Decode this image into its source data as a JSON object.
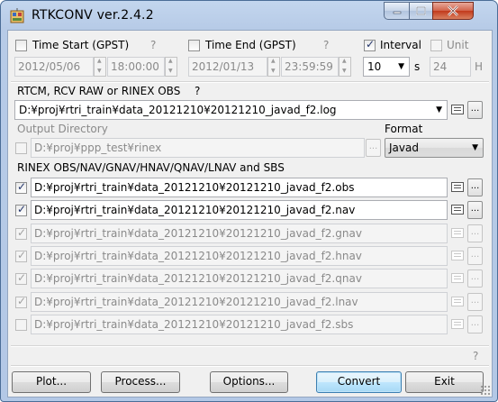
{
  "window": {
    "title": "RTKCONV ver.2.4.2"
  },
  "time": {
    "start_label": "Time Start (GPST)",
    "start_help": "?",
    "start_date": "2012/05/06",
    "start_time": "18:00:00",
    "start_checked": false,
    "end_label": "Time End (GPST)",
    "end_help": "?",
    "end_date": "2012/01/13",
    "end_time": "23:59:59",
    "end_checked": false,
    "interval_label": "Interval",
    "interval_checked": true,
    "interval_value": "10",
    "interval_unit": "s",
    "unit_label": "Unit",
    "unit_checked": false,
    "unit_value": "24",
    "unit_suffix": "H"
  },
  "input": {
    "section_label": "RTCM, RCV RAW or RINEX OBS",
    "help": "?",
    "file": "D:¥proj¥rtri_train¥data_20121210¥20121210_javad_f2.log"
  },
  "output_dir": {
    "label": "Output Directory",
    "value": "D:¥proj¥ppp_test¥rinex",
    "checked": false
  },
  "format": {
    "label": "Format",
    "value": "Javad"
  },
  "outputs": {
    "section_label": "RINEX OBS/NAV/GNAV/HNAV/QNAV/LNAV and SBS",
    "files": [
      {
        "path": "D:¥proj¥rtri_train¥data_20121210¥20121210_javad_f2.obs",
        "checked": true,
        "enabled": true
      },
      {
        "path": "D:¥proj¥rtri_train¥data_20121210¥20121210_javad_f2.nav",
        "checked": true,
        "enabled": true
      },
      {
        "path": "D:¥proj¥rtri_train¥data_20121210¥20121210_javad_f2.gnav",
        "checked": true,
        "enabled": false
      },
      {
        "path": "D:¥proj¥rtri_train¥data_20121210¥20121210_javad_f2.hnav",
        "checked": true,
        "enabled": false
      },
      {
        "path": "D:¥proj¥rtri_train¥data_20121210¥20121210_javad_f2.qnav",
        "checked": true,
        "enabled": false
      },
      {
        "path": "D:¥proj¥rtri_train¥data_20121210¥20121210_javad_f2.lnav",
        "checked": true,
        "enabled": false
      },
      {
        "path": "D:¥proj¥rtri_train¥data_20121210¥20121210_javad_f2.sbs",
        "checked": false,
        "enabled": false
      }
    ]
  },
  "status": {
    "help": "?"
  },
  "buttons": {
    "browse": "...",
    "plot": "Plot...",
    "process": "Process...",
    "options": "Options...",
    "convert": "Convert",
    "exit": "Exit"
  },
  "colors": {
    "title_bar": "#b9cde8",
    "close_button": "#c7432a",
    "client_bg": "#f0f0f0",
    "focus_border": "#3c7fb1"
  }
}
